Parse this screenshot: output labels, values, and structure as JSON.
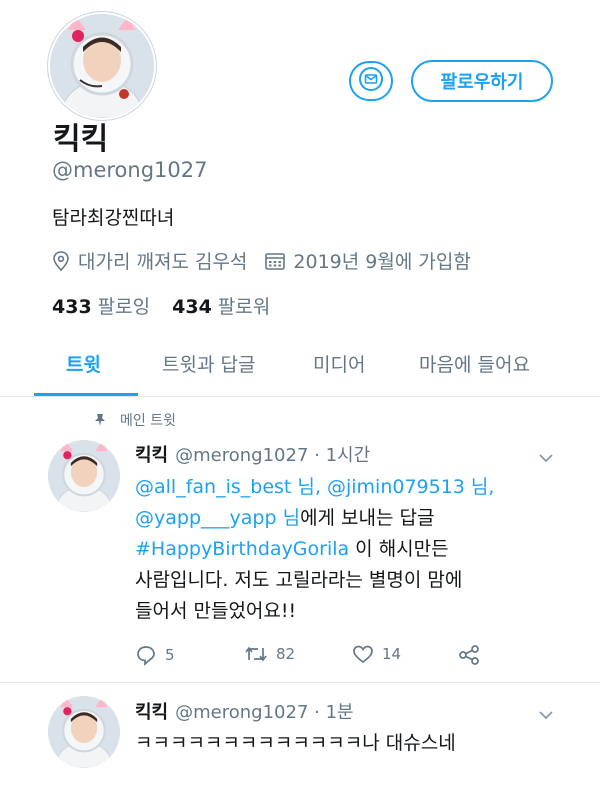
{
  "profile": {
    "name": "킥킥",
    "handle": "@merong1027",
    "bio": "탐라최강찐따녀",
    "location": "대가리 깨져도 김우석",
    "joined": "2019년 9월에 가입함",
    "following_count": "433",
    "following_label": "팔로잉",
    "followers_count": "434",
    "followers_label": "팔로워",
    "follow_button": "팔로우하기"
  },
  "tabs": [
    "트윗",
    "트윗과 답글",
    "미디어",
    "마음에 들어요"
  ],
  "pinned_label": "메인 트윗",
  "tweets": [
    {
      "name": "킥킥",
      "handle": "@merong1027",
      "time": "· 1시간",
      "mention1": "@all_fan_is_best",
      "nim1": " 님, ",
      "mention2": "@jimin079513",
      "nim2": " 님,",
      "mention3": "@yapp___yapp",
      "nim3": " 님",
      "reply_suffix": "에게 보내는 답글",
      "hashtag": "#HappyBirthdayGorila",
      "text1_rest": " 이 해시만든",
      "text2": "사람입니다. 저도 고릴라라는 별명이 맘에",
      "text3": "들어서 만들었어요!!",
      "replies": "5",
      "retweets": "82",
      "likes": "14"
    },
    {
      "name": "킥킥",
      "handle": "@merong1027",
      "time": "· 1분",
      "text": "ㅋㅋㅋㅋㅋㅋㅋㅋㅋㅋㅋㅋㅋ나 대슈스네"
    }
  ],
  "colors": {
    "accent": "#1da1f2",
    "secondary_text": "#657786",
    "primary_text": "#14171a"
  },
  "icons": [
    "mail-icon",
    "location-pin-icon",
    "calendar-icon",
    "pin-icon",
    "chevron-down-icon",
    "reply-icon",
    "retweet-icon",
    "like-icon",
    "share-icon"
  ]
}
